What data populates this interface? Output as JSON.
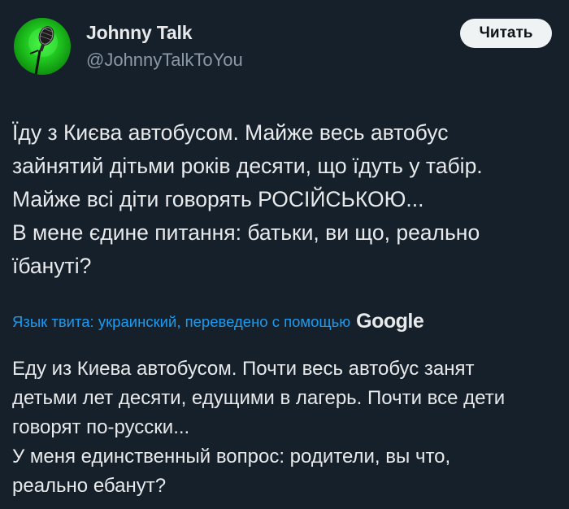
{
  "author": {
    "name": "Johnny Talk",
    "handle": "@JohnnyTalkToYou",
    "avatar_icon": "microphone-icon",
    "avatar_color": "#22c322"
  },
  "actions": {
    "follow_label": "Читать"
  },
  "tweet": {
    "original_text": "Їду з Києва автобусом. Майже весь автобус\nзайнятий дітьми років десяти, що їдуть у табір.\nМайже всі діти говорять РОСІЙСЬКОЮ...\nВ мене єдине питання: батьки, ви що, реально\nїбануті?",
    "translation_label": "Язык твита: украинский, переведено с помощью",
    "translation_provider": "Google",
    "translated_text": "Еду из Киева автобусом. Почти весь автобус занят\nдетьми лет десяти, едущими в лагерь. Почти все дети\nговорят по-русски...\nУ меня единственный вопрос: родители, вы что,\nреально ебанут?"
  },
  "colors": {
    "background": "#15202b",
    "text": "#e7e9ea",
    "secondary_text": "#8b98a5",
    "link": "#1d9bf0",
    "button_bg": "#eff3f4"
  }
}
